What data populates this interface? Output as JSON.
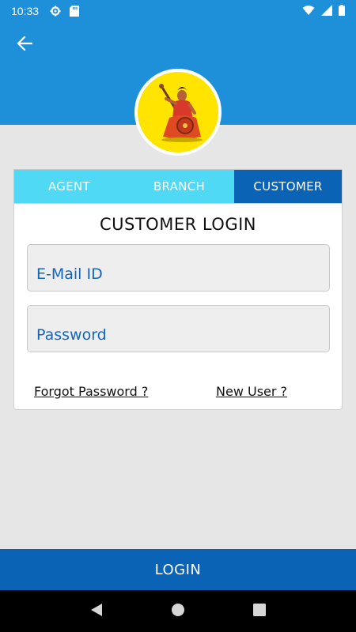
{
  "status_bar": {
    "time": "10:33",
    "icons": [
      "gear-icon",
      "sd-card-icon",
      "wifi-icon",
      "cell-signal-icon",
      "battery-icon"
    ]
  },
  "header": {
    "back_icon": "arrow-left-icon",
    "logo": "logo-avatar"
  },
  "tabs": [
    {
      "label": "AGENT",
      "active": false
    },
    {
      "label": "BRANCH",
      "active": false
    },
    {
      "label": "CUSTOMER",
      "active": true
    }
  ],
  "login_card": {
    "title": "CUSTOMER LOGIN",
    "email_placeholder": "E-Mail ID",
    "email_value": "",
    "password_placeholder": "Password",
    "password_value": "",
    "forgot_password": "Forgot Password ?",
    "new_user": "New User ?"
  },
  "login_button": {
    "label": "LOGIN"
  },
  "nav_bar": {
    "icons": [
      "back-triangle-icon",
      "home-circle-icon",
      "recents-square-icon"
    ]
  },
  "colors": {
    "header_blue": "#1e8fd9",
    "tab_inactive": "#4fd9f5",
    "tab_active": "#0b63b5",
    "login_button": "#0b63b5",
    "field_text": "#1565c0",
    "logo_yellow": "#ffe400"
  }
}
